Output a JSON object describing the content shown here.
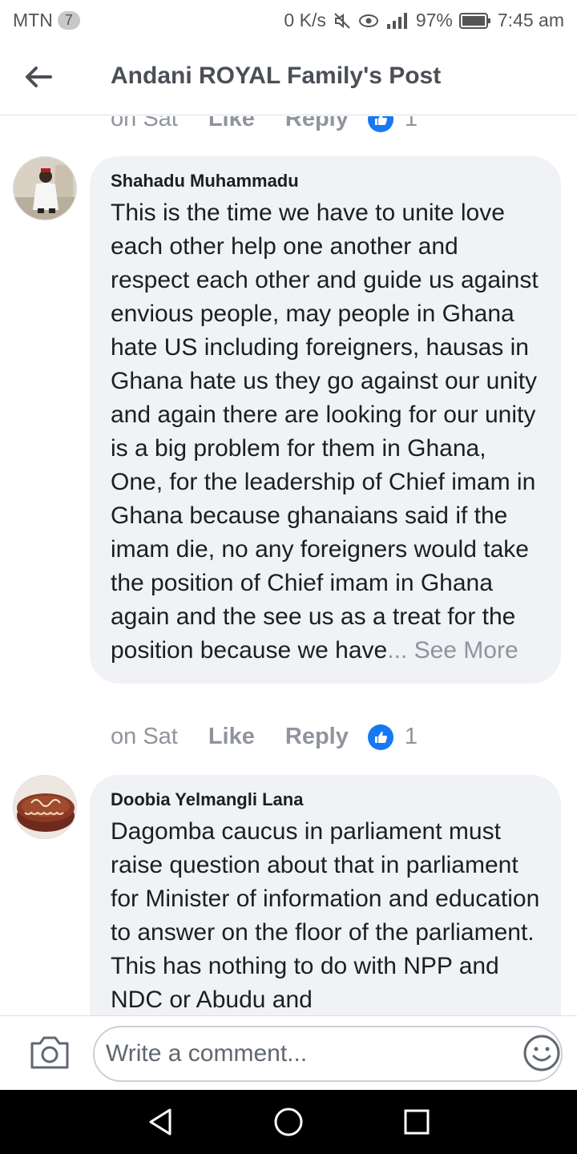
{
  "status_bar": {
    "carrier": "MTN",
    "sim_badge": "7",
    "net_speed": "0 K/s",
    "battery": "97%",
    "time": "7:45 am"
  },
  "header": {
    "title": "Andani ROYAL Family's Post",
    "back_icon": "arrow-left-icon"
  },
  "feed": {
    "previous_meta": {
      "time": "on Sat",
      "like": "Like",
      "reply": "Reply",
      "likes": "1"
    },
    "comments": [
      {
        "author": "Shahadu Muhammadu",
        "text": "This is the time we have to unite love each other help one another and respect each other and guide us against envious people, may people in Ghana hate US including foreigners, hausas in Ghana hate us they go against our unity and again there are looking for our unity is a big problem for them in Ghana, One, for the leadership of Chief imam in Ghana because ghanaians said if the imam die, no any foreigners would take the position of Chief imam in Ghana again and the see us as a treat for the position because we have",
        "see_more": "... See More",
        "meta": {
          "time": "on Sat",
          "like": "Like",
          "reply": "Reply",
          "likes": "1"
        }
      },
      {
        "author": "Doobia Yelmangli Lana",
        "text": "Dagomba caucus in parliament must raise question about that in parliament for Minister of information and education to answer on the floor of the parliament. This has nothing to do with NPP and NDC or Abudu and"
      }
    ]
  },
  "composer": {
    "placeholder": "Write a comment...",
    "camera_icon": "camera-icon",
    "emoji_icon": "smiley-icon"
  },
  "colors": {
    "accent": "#1877f2",
    "bubble": "#f0f2f5",
    "meta_text": "#90949c"
  }
}
